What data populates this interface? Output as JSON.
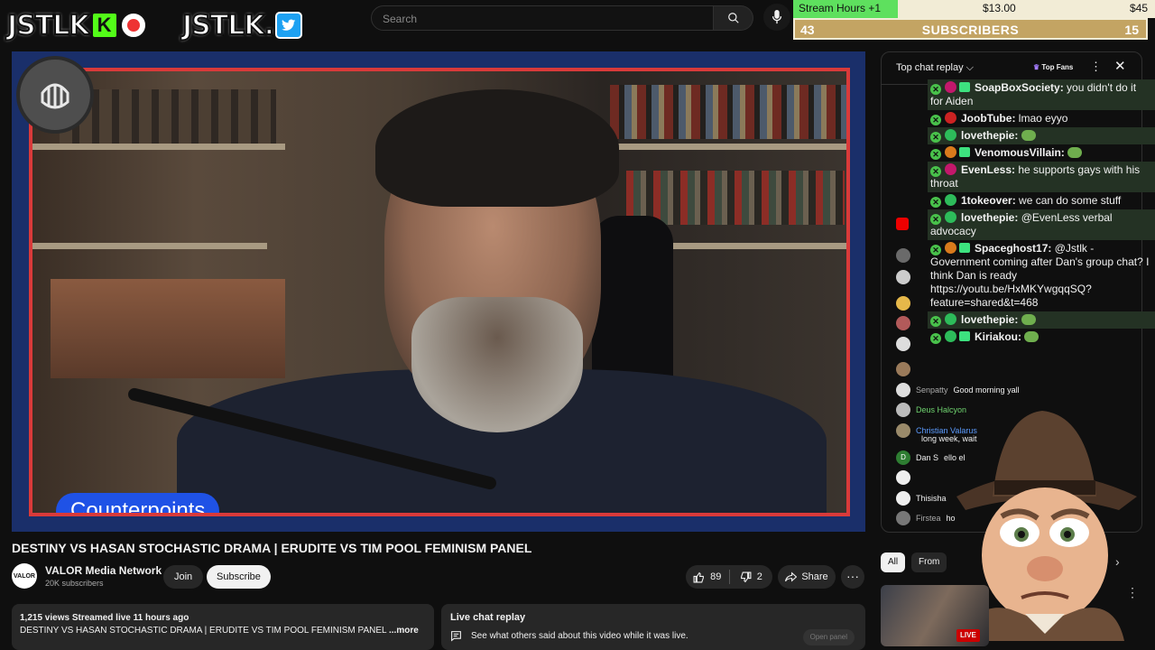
{
  "header": {
    "logo1_text": "JSTLK",
    "logo1_badge": "K",
    "logo2_text": "JSTLK.",
    "search_placeholder": "Search"
  },
  "widget": {
    "stream_hours_label": "Stream Hours +1",
    "amount1": "$13.00",
    "amount2": "$45",
    "subs_left": "43",
    "subs_label": "SUBSCRIBERS",
    "subs_right": "15",
    "progress_fraction": 0.29
  },
  "video": {
    "overlay_label": "Counterpoints",
    "title": "DESTINY VS HASAN STOCHASTIC DRAMA | ERUDITE VS TIM POOL FEMINISM PANEL"
  },
  "channel": {
    "avatar_text": "VALOR",
    "name": "VALOR Media Network",
    "subscribers": "20K subscribers",
    "join_label": "Join",
    "subscribe_label": "Subscribe"
  },
  "actions": {
    "likes": "89",
    "dislikes": "2",
    "share_label": "Share",
    "more_label": "···"
  },
  "description": {
    "meta": "1,215 views  Streamed live 11 hours ago",
    "text": "DESTINY VS HASAN STOCHASTIC DRAMA | ERUDITE VS TIM POOL FEMINISM PANEL",
    "more": "...more"
  },
  "live_chat_replay": {
    "title": "Live chat replay",
    "subtitle": "See what others said about this video while it was live.",
    "open_panel": "Open panel"
  },
  "chat_panel": {
    "title": "Top chat replay",
    "top_fans": "Top Fans",
    "messages": [
      {
        "name": "Senpatty",
        "text": "Good morning yall",
        "color": ""
      },
      {
        "name": "Deus Halcyon",
        "text": "",
        "color": "green"
      },
      {
        "name": "Christian Valarus",
        "text": "long week, wait",
        "color": "blue"
      },
      {
        "name": "Dan S",
        "text": "ello el",
        "color": ""
      },
      {
        "name": "Thisisha",
        "text": "",
        "color": ""
      },
      {
        "name": "Firstea",
        "text": "ho",
        "color": ""
      }
    ]
  },
  "overlay_chat": [
    {
      "name": "SoapBoxSociety:",
      "text": "you didn't do it for Aiden",
      "dot": "#c2186b",
      "gift": true,
      "hl": true
    },
    {
      "name": "JoobTube:",
      "text": "lmao eyyo",
      "dot": "#cc2222",
      "gift": false,
      "hl": false
    },
    {
      "name": "lovethepie:",
      "text": "",
      "dot": "#2dbb5a",
      "gift": false,
      "hl": true,
      "emote": true
    },
    {
      "name": "VenomousVillain:",
      "text": "",
      "dot": "#d97a1c",
      "gift": true,
      "hl": false,
      "emote": true
    },
    {
      "name": "EvenLess:",
      "text": "he supports gays with his throat",
      "dot": "#c2186b",
      "gift": false,
      "hl": true
    },
    {
      "name": "1tokeover:",
      "text": "we can do some stuff",
      "dot": "#2dbb5a",
      "gift": false,
      "hl": false
    },
    {
      "name": "lovethepie:",
      "text": "@EvenLess verbal advocacy",
      "dot": "#2dbb5a",
      "gift": false,
      "hl": true
    },
    {
      "name": "Spaceghost17:",
      "text": "@Jstlk - Government coming after Dan's group chat? I think Dan is ready https://youtu.be/HxMKYwgqqSQ?feature=shared&t=468",
      "dot": "#d97a1c",
      "gift": true,
      "hl": false
    },
    {
      "name": "lovethepie:",
      "text": "",
      "dot": "#2dbb5a",
      "gift": false,
      "hl": true,
      "emote": true
    },
    {
      "name": "Kiriakou:",
      "text": "",
      "dot": "#2dbb5a",
      "gift": true,
      "hl": false,
      "emote": true
    }
  ],
  "recommendations": {
    "chip_all": "All",
    "chip_from": "From",
    "live_badge": "LIVE"
  }
}
